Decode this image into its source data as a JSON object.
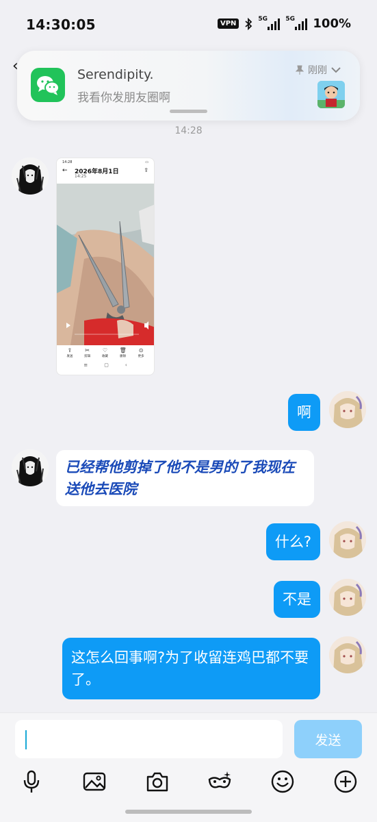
{
  "status_bar": {
    "time": "14:30:05",
    "vpn": "VPN",
    "signal_1": "5G",
    "signal_2": "5G",
    "battery": "100%"
  },
  "notification": {
    "sender": "Serendipity.",
    "message": "我看你发朋友圈啊",
    "time": "刚刚"
  },
  "chat": {
    "timestamp": "14:28",
    "image_message": {
      "status_time": "14:28",
      "title": "2026年8月1日",
      "subtitle": "14:25",
      "tools": [
        "发送",
        "剪辑",
        "收藏",
        "删除",
        "更多"
      ]
    },
    "messages": [
      {
        "side": "out",
        "text": "啊"
      },
      {
        "side": "in",
        "text": "已经帮他剪掉了他不是男的了我现在送他去医院"
      },
      {
        "side": "out",
        "text": "什么?"
      },
      {
        "side": "out",
        "text": "不是"
      },
      {
        "side": "out",
        "text": "这怎么回事啊?为了收留连鸡巴都不要了。"
      }
    ]
  },
  "composer": {
    "input_value": "",
    "send_label": "发送"
  },
  "colors": {
    "outgoing_bubble": "#0e9bf6",
    "incoming_text": "#1a4ab8",
    "send_button": "#8ed0fb",
    "wechat_green": "#21c35a"
  }
}
